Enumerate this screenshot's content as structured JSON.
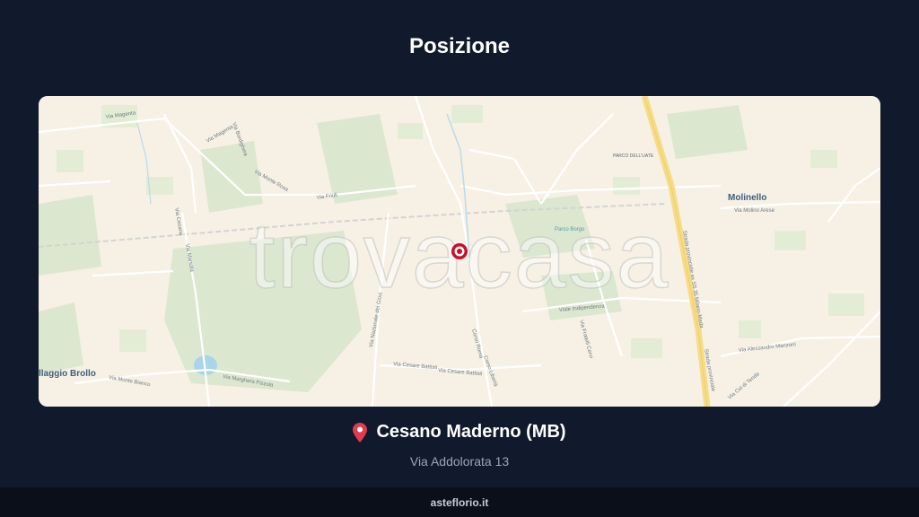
{
  "page": {
    "title": "Posizione"
  },
  "map": {
    "watermark": "trovacasa",
    "labels": {
      "via_magenta": "Via Magenta",
      "via_magenta_2": "Via Magenta",
      "via_bordighera": "Via Bordighera",
      "via_monte_rosa": "Via Monte Rosa",
      "via_friuli": "Via Friuli",
      "via_cesana": "Via Cesana",
      "via_marsala": "Via Marsala",
      "villaggio_brollo": "llaggio Brollo",
      "via_monte_bianco": "Via Monte Bianco",
      "via_marghera": "Via Marghera Pizzola",
      "via_nazionale_dei_giovi": "Via Nazionale dei Giovi",
      "via_cesare_battisti": "Via Cesare Battisti",
      "via_cesare_battisti_2": "Via Cesare Battisti",
      "corso_roma": "Corso Roma",
      "corso_libertà": "Corso Libertà",
      "viale_indipendenza": "Viale Indipendenza",
      "via_fratelli_cervi": "Via Fratelli Cervi",
      "parco_delle_orchidee": "Parco Borgo",
      "parco_dell_uate": "PARCO DELL'UATE",
      "molinello": "Molinello",
      "via_molino_arese": "Via Molino Arese",
      "via_alessandro_manzoni": "Via Alessandro Manzoni",
      "via_col_di_tenda": "Via Col di Tenda",
      "strada_provinciale": "Strada provinciale ex SS 35 Milano-Meda",
      "strada_provinciale_2": "Strada provinciale"
    }
  },
  "location": {
    "pin_icon": "red-map-pin",
    "city": "Cesano Maderno (MB)",
    "address": "Via Addolorata 13"
  },
  "footer": {
    "brand": "asteflorio.it"
  }
}
